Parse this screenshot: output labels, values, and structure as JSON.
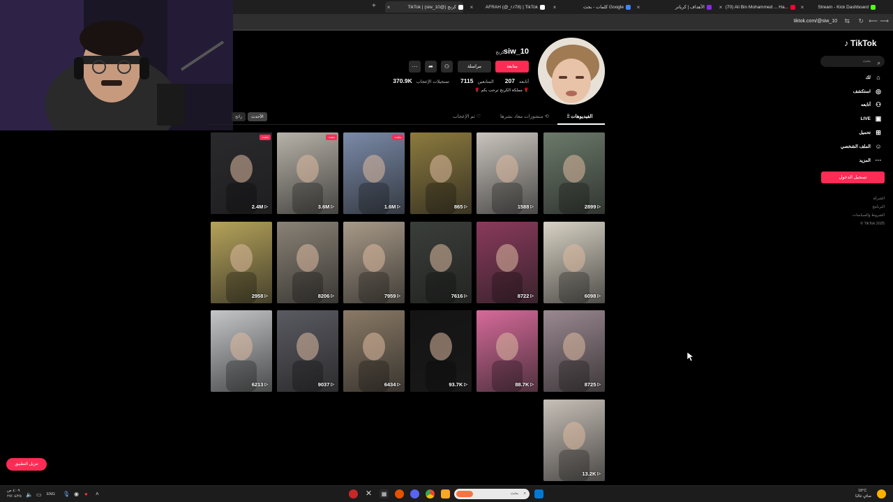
{
  "browser": {
    "tabs": [
      {
        "label": "TikTok | (siw_10@) كرنج",
        "color": "#ffffff",
        "active": true
      },
      {
        "label": "AFRAH (@_r.r78) | TikTok",
        "color": "#ffffff",
        "active": false
      },
      {
        "label": "كلمات - بحث Google",
        "color": "#4285f4",
        "active": false
      },
      {
        "label": "الأهداف | كرياتر",
        "color": "#8a2be2",
        "active": false
      },
      {
        "label": "(70) Ali Bin Mohammed ... Ha...",
        "color": "#ff0033",
        "active": false
      },
      {
        "label": "Stream - Kick Dashboard",
        "color": "#53fc18",
        "active": false
      }
    ],
    "new_tab": "+",
    "url": "tiktok.com/@siw_10"
  },
  "sidebar": {
    "logo": "TikTok",
    "search_placeholder": "بحث",
    "items": [
      {
        "label": "لك",
        "icon": "home-icon",
        "glyph": "⌂"
      },
      {
        "label": "استكشف",
        "icon": "compass-icon",
        "glyph": "◎"
      },
      {
        "label": "أتابعه",
        "icon": "following-icon",
        "glyph": "⚇"
      },
      {
        "label": "LIVE",
        "icon": "live-icon",
        "glyph": "▣"
      },
      {
        "label": "تحميل",
        "icon": "upload-icon",
        "glyph": "⊞"
      },
      {
        "label": "الملف الشخصي",
        "icon": "profile-icon",
        "glyph": "☺"
      },
      {
        "label": "المزيد",
        "icon": "more-icon",
        "glyph": "···"
      }
    ],
    "login_label": "تسجيل الدخول",
    "footer": [
      "الشركة",
      "البرنامج",
      "الشروط والسياسات",
      "© TikTok 2025"
    ]
  },
  "profile": {
    "username": "siw_10",
    "nickname": "كرنج",
    "follow_label": "متابعة",
    "message_label": "مراسلة",
    "following_count": "207",
    "following_label": "أتابعه",
    "followers_count": "7115",
    "followers_label": "المتابعين",
    "likes_count": "370.9K",
    "likes_label": "تسجيلات الإعجاب",
    "bio": "🌹 مملكة الكرنج ترحب بكم 🌹",
    "tabs": [
      {
        "label": "الفيديوهات",
        "active": true
      },
      {
        "label": "منشورات معاد نشرها",
        "active": false
      },
      {
        "label": "تم الإعجاب",
        "active": false
      }
    ],
    "filters": [
      {
        "label": "الأحدث",
        "active": true
      },
      {
        "label": "رائج",
        "active": false
      }
    ]
  },
  "videos": [
    {
      "views": "2899",
      "bg": "#6b7a6a",
      "pinned": false,
      "caption": ""
    },
    {
      "views": "1588",
      "bg": "#c9c4bd",
      "pinned": false,
      "caption": ""
    },
    {
      "views": "865",
      "bg": "#8c7a3e",
      "pinned": false,
      "caption": ""
    },
    {
      "views": "1.6M",
      "bg": "#7a8aa8",
      "pinned": true,
      "caption": ""
    },
    {
      "views": "3.6M",
      "bg": "#b7b2a8",
      "pinned": true,
      "caption": ""
    },
    {
      "views": "2.4M",
      "bg": "#2a2a2e",
      "pinned": true,
      "caption": ""
    },
    {
      "views": "6098",
      "bg": "#d8d2c4",
      "pinned": false,
      "caption": ""
    },
    {
      "views": "8722",
      "bg": "#8a3a5c",
      "pinned": false,
      "caption": ""
    },
    {
      "views": "7616",
      "bg": "#3a3e3a",
      "pinned": false,
      "caption": ""
    },
    {
      "views": "7959",
      "bg": "#a89a88",
      "pinned": false,
      "caption": ""
    },
    {
      "views": "8206",
      "bg": "#8a8276",
      "pinned": false,
      "caption": ""
    },
    {
      "views": "2958",
      "bg": "#b5a35a",
      "pinned": false,
      "caption": ""
    },
    {
      "views": "8725",
      "bg": "#9a8890",
      "pinned": false,
      "caption": ""
    },
    {
      "views": "88.7K",
      "bg": "#d66a9a",
      "pinned": false,
      "caption": ""
    },
    {
      "views": "93.7K",
      "bg": "#141414",
      "pinned": false,
      "caption": ""
    },
    {
      "views": "6434",
      "bg": "#8a7a66",
      "pinned": false,
      "caption": ""
    },
    {
      "views": "9037",
      "bg": "#5a5a62",
      "pinned": false,
      "caption": ""
    },
    {
      "views": "6213",
      "bg": "#c4c6c8",
      "pinned": false,
      "caption": ""
    },
    {
      "views": "13.2K",
      "bg": "#c8c0b8",
      "pinned": false,
      "caption": ""
    }
  ],
  "pinned_label": "مثبت",
  "install_label": "تنزيل التطبيق",
  "taskbar": {
    "search_placeholder": "بحث",
    "lang": "ENG",
    "weather": "18°C",
    "weather_desc": "صافٍ غالبًا",
    "time": "٤:٠٩ ص",
    "date": "٢٧/٠٤/٢٥"
  },
  "colors": {
    "accent": "#fe2c55",
    "bg": "#000000"
  }
}
